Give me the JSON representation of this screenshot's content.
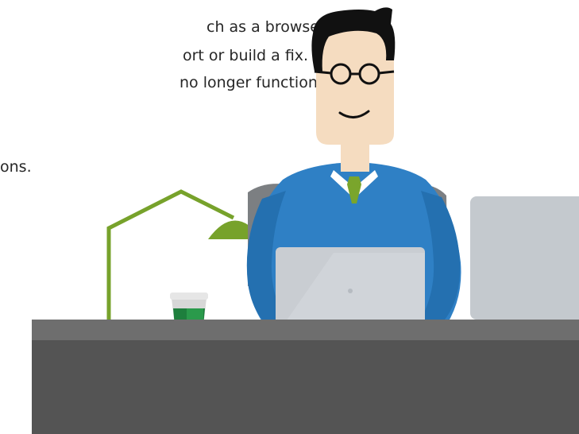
{
  "text": {
    "line1": "ch as a browser",
    "line2": "ort or build a fix.",
    "line3": "no longer function.",
    "line4": "",
    "line5": "ons."
  },
  "colors": {
    "desk_top": "#6e6e6e",
    "desk_front": "#545454",
    "lamp": "#77a22b",
    "sweater": "#2f80c5",
    "tie": "#7aa52c",
    "laptop": "#c9cdd2",
    "monitor": "#c4c9ce",
    "skin": "#f5dcc0",
    "hair": "#111111",
    "chair": "#7c7f82",
    "cup_band": "#1e7f3d"
  },
  "icons": {
    "person": "person-illustration",
    "lamp": "desk-lamp-icon",
    "cup": "coffee-cup-icon",
    "laptop": "laptop-icon",
    "monitor": "monitor-icon"
  }
}
